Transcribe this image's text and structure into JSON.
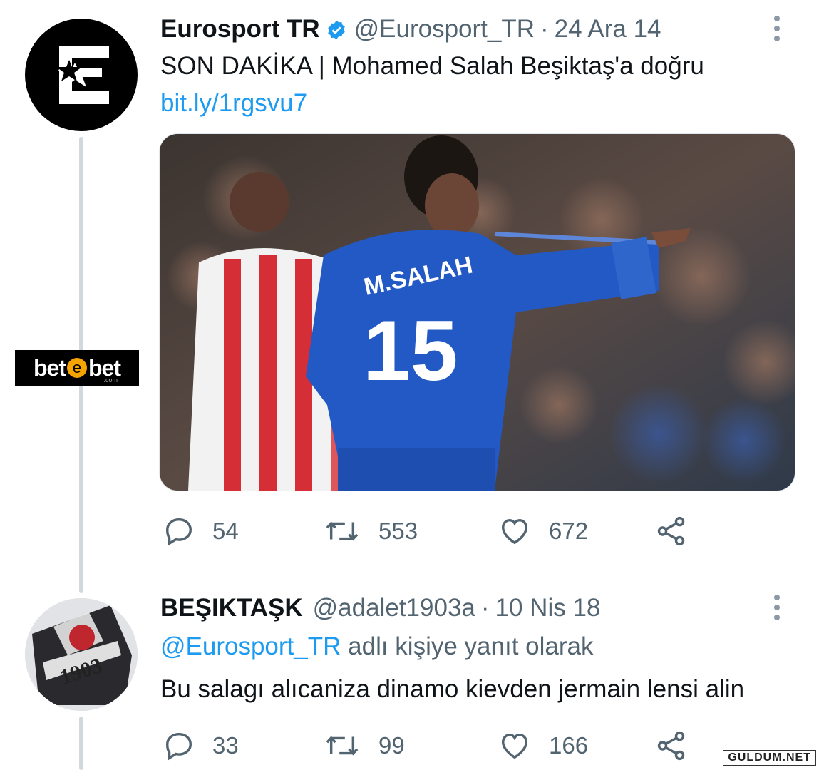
{
  "tweet1": {
    "name": "Eurosport TR",
    "handle": "@Eurosport_TR",
    "separator": "·",
    "date": "24 Ara 14",
    "text": "SON DAKİKA | Mohamed Salah Beşiktaş'a doğru",
    "link": "bit.ly/1rgsvu7",
    "media_jersey_name": "M.SALAH",
    "media_jersey_number": "15",
    "actions": {
      "replies": "54",
      "retweets": "553",
      "likes": "672"
    }
  },
  "tweet2": {
    "name": "BEŞIKTAŞK",
    "handle": "@adalet1903a",
    "separator": "·",
    "date": "10 Nis 18",
    "reply_to_handle": "@Eurosport_TR",
    "reply_to_suffix": "adlı kişiye yanıt olarak",
    "text": "Bu salagı alıcaniza dinamo kievden jermain lensi alin",
    "avatar_text": "1903",
    "actions": {
      "replies": "33",
      "retweets": "99",
      "likes": "166"
    }
  },
  "sponsor": {
    "left": "bet",
    "mid": "e",
    "right": "bet",
    "sub": ".com"
  },
  "watermark": "GULDUM.NET",
  "colors": {
    "link": "#1d9bf0",
    "muted": "#536471",
    "verified": "#1d9bf0",
    "thread_line": "#cfd9de"
  },
  "icons": [
    "verified-badge-icon",
    "more-options-icon",
    "reply-icon",
    "retweet-icon",
    "like-icon",
    "share-icon"
  ]
}
